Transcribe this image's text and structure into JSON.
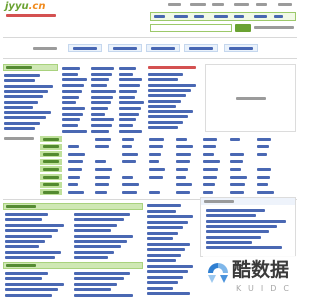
{
  "header": {
    "logo_main": "jyyu",
    "logo_tld": ".cn"
  },
  "watermark": {
    "brand": "酷数据",
    "latin": "KUIDC",
    "icon": "kuidc-logo-icon"
  },
  "colors": {
    "link": "#2a4ea6",
    "text_gray": "#8a8a8a",
    "accent_red": "#cc3333",
    "accent_green": "#6aa232",
    "header_green_text": "#3f7a1c",
    "tld_orange": "#f08a1d"
  }
}
